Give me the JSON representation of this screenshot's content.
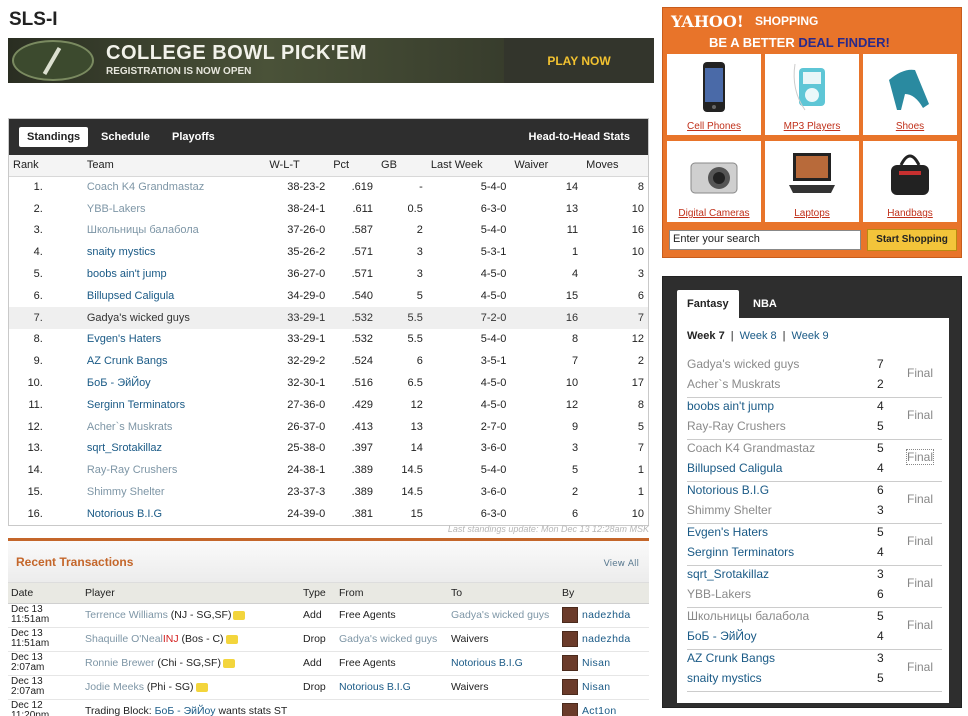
{
  "league_title": "SLS-I",
  "banner": {
    "title": "COLLEGE BOWL PICK'EM",
    "subtitle": "REGISTRATION IS NOW OPEN",
    "cta": "PLAY NOW"
  },
  "standings": {
    "tabs": [
      "Standings",
      "Schedule",
      "Playoffs"
    ],
    "h2h_tab": "Head-to-Head Stats",
    "columns": [
      "Rank",
      "Team",
      "W-L-T",
      "Pct",
      "GB",
      "Last Week",
      "Waiver",
      "Moves"
    ],
    "rows": [
      [
        "1.",
        "Coach K4 Grandmastaz",
        "38-23-2",
        ".619",
        "-",
        "5-4-0",
        "14",
        "8"
      ],
      [
        "2.",
        "YBB-Lakers",
        "38-24-1",
        ".611",
        "0.5",
        "6-3-0",
        "13",
        "10"
      ],
      [
        "3.",
        "Школьницы балабола",
        "37-26-0",
        ".587",
        "2",
        "5-4-0",
        "11",
        "16"
      ],
      [
        "4.",
        "snaity mystics",
        "35-26-2",
        ".571",
        "3",
        "5-3-1",
        "1",
        "10"
      ],
      [
        "5.",
        "boobs ain't jump",
        "36-27-0",
        ".571",
        "3",
        "4-5-0",
        "4",
        "3"
      ],
      [
        "6.",
        "Billupsed Caligula",
        "34-29-0",
        ".540",
        "5",
        "4-5-0",
        "15",
        "6"
      ],
      [
        "7.",
        "Gadya's wicked guys",
        "33-29-1",
        ".532",
        "5.5",
        "7-2-0",
        "16",
        "7"
      ],
      [
        "8.",
        "Evgen's Haters",
        "33-29-1",
        ".532",
        "5.5",
        "5-4-0",
        "8",
        "12"
      ],
      [
        "9.",
        "AZ Crunk Bangs",
        "32-29-2",
        ".524",
        "6",
        "3-5-1",
        "7",
        "2"
      ],
      [
        "10.",
        "БоБ - ЭйЙоу",
        "32-30-1",
        ".516",
        "6.5",
        "4-5-0",
        "10",
        "17"
      ],
      [
        "11.",
        "Serginn Terminators",
        "27-36-0",
        ".429",
        "12",
        "4-5-0",
        "12",
        "8"
      ],
      [
        "12.",
        "Acher`s Muskrats",
        "26-37-0",
        ".413",
        "13",
        "2-7-0",
        "9",
        "5"
      ],
      [
        "13.",
        "sqrt_Srotakillaz",
        "25-38-0",
        ".397",
        "14",
        "3-6-0",
        "3",
        "7"
      ],
      [
        "14.",
        "Ray-Ray Crushers",
        "24-38-1",
        ".389",
        "14.5",
        "5-4-0",
        "5",
        "1"
      ],
      [
        "15.",
        "Shimmy Shelter",
        "23-37-3",
        ".389",
        "14.5",
        "3-6-0",
        "2",
        "1"
      ],
      [
        "16.",
        "Notorious B.I.G",
        "24-39-0",
        ".381",
        "15",
        "6-3-0",
        "6",
        "10"
      ]
    ],
    "update_text": "Last standings update: Mon Dec 13 12:28am MSK"
  },
  "transactions": {
    "title": "Recent Transactions",
    "view_all": "View All",
    "columns": [
      "Date",
      "Player",
      "Type",
      "From",
      "To",
      "By"
    ],
    "rows": [
      {
        "d1": "Dec 13",
        "d2": "11:51am",
        "player": "Terrence Williams",
        "pos": " (NJ - SG,SF)",
        "inj": "",
        "type": "Add",
        "from": "Free Agents",
        "to": "Gadya's wicked guys",
        "by": "nadezhda"
      },
      {
        "d1": "Dec 13",
        "d2": "11:51am",
        "player": "Shaquille O'Neal",
        "pos": " (Bos - C)",
        "inj": "INJ",
        "type": "Drop",
        "from": "Gadya's wicked guys",
        "to": "Waivers",
        "by": "nadezhda"
      },
      {
        "d1": "Dec 13",
        "d2": "2:07am",
        "player": "Ronnie Brewer",
        "pos": " (Chi - SG,SF)",
        "inj": "",
        "type": "Add",
        "from": "Free Agents",
        "to": "Notorious B.I.G",
        "by": "Nisan"
      },
      {
        "d1": "Dec 13",
        "d2": "2:07am",
        "player": "Jodie Meeks",
        "pos": " (Phi - SG)",
        "inj": "",
        "type": "Drop",
        "from": "Notorious B.I.G",
        "to": "Waivers",
        "by": "Nisan"
      }
    ],
    "last_row": {
      "d1": "Dec 12",
      "d2": "11:20pm",
      "prefix": "Trading Block: ",
      "team": "БоБ - ЭйЙоу",
      "suffix": " wants stats ST",
      "by": "Act1on"
    }
  },
  "ad": {
    "logo": "YAHOO!",
    "shopping": "SHOPPING",
    "tagline_a": "BE A BETTER ",
    "tagline_b": "DEAL FINDER!",
    "products": [
      "Cell Phones",
      "MP3 Players",
      "Shoes",
      "Digital Cameras",
      "Laptops",
      "Handbags"
    ],
    "search_value": "Enter your search",
    "button": "Start Shopping"
  },
  "scoreboard": {
    "tabs": [
      "Fantasy",
      "NBA"
    ],
    "weeks": [
      "Week 7",
      "Week 8",
      "Week 9"
    ],
    "matchups": [
      {
        "t1": "Gadya's wicked guys",
        "s1": "7",
        "t2": "Acher`s Muskrats",
        "s2": "2",
        "status": "Final"
      },
      {
        "t1": "boobs ain't jump",
        "s1": "4",
        "t2": "Ray-Ray Crushers",
        "s2": "5",
        "status": "Final"
      },
      {
        "t1": "Coach K4 Grandmastaz",
        "s1": "5",
        "t2": "Billupsed Caligula",
        "s2": "4",
        "status": "Final"
      },
      {
        "t1": "Notorious B.I.G",
        "s1": "6",
        "t2": "Shimmy Shelter",
        "s2": "3",
        "status": "Final"
      },
      {
        "t1": "Evgen's Haters",
        "s1": "5",
        "t2": "Serginn Terminators",
        "s2": "4",
        "status": "Final"
      },
      {
        "t1": "sqrt_Srotakillaz",
        "s1": "3",
        "t2": "YBB-Lakers",
        "s2": "6",
        "status": "Final"
      },
      {
        "t1": "Школьницы балабола",
        "s1": "5",
        "t2": "БоБ - ЭйЙоу",
        "s2": "4",
        "status": "Final"
      },
      {
        "t1": "AZ Crunk Bangs",
        "s1": "3",
        "t2": "snaity mystics",
        "s2": "5",
        "status": "Final"
      }
    ]
  },
  "colors": {
    "accent_orange": "#c4662a",
    "link_blue": "#1a5a86",
    "muted_team": "#7e96a6",
    "tab_bar": "#2e2e2e"
  }
}
